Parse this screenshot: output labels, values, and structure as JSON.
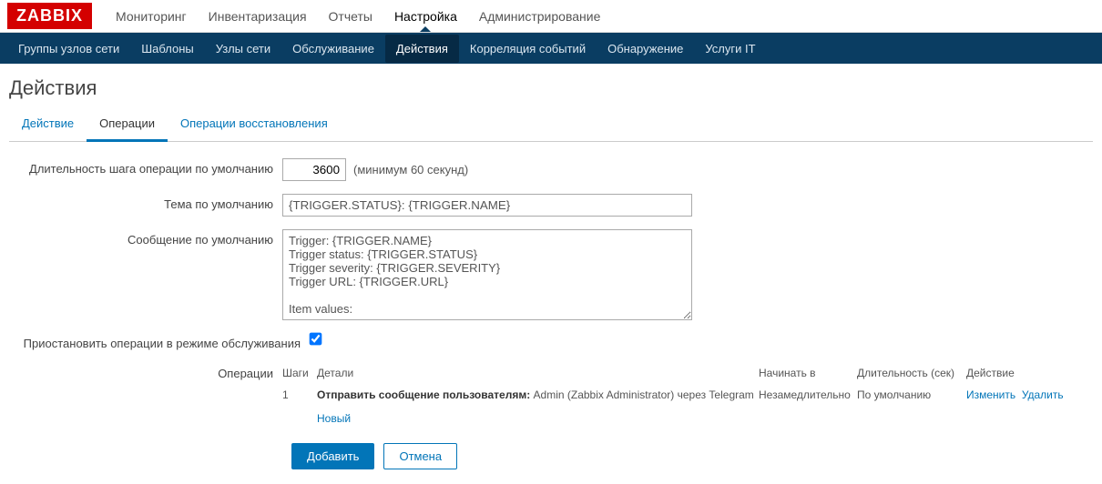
{
  "logo": "ZABBIX",
  "topnav": {
    "items": [
      {
        "label": "Мониторинг"
      },
      {
        "label": "Инвентаризация"
      },
      {
        "label": "Отчеты"
      },
      {
        "label": "Настройка",
        "active": true
      },
      {
        "label": "Администрирование"
      }
    ]
  },
  "subnav": {
    "items": [
      {
        "label": "Группы узлов сети"
      },
      {
        "label": "Шаблоны"
      },
      {
        "label": "Узлы сети"
      },
      {
        "label": "Обслуживание"
      },
      {
        "label": "Действия",
        "active": true
      },
      {
        "label": "Корреляция событий"
      },
      {
        "label": "Обнаружение"
      },
      {
        "label": "Услуги IT"
      }
    ]
  },
  "page": {
    "title": "Действия"
  },
  "tabs": {
    "items": [
      {
        "label": "Действие"
      },
      {
        "label": "Операции",
        "active": true
      },
      {
        "label": "Операции восстановления"
      }
    ]
  },
  "form": {
    "step_duration": {
      "label": "Длительность шага операции по умолчанию",
      "value": "3600",
      "hint": "(минимум 60 секунд)"
    },
    "default_subject": {
      "label": "Тема по умолчанию",
      "value": "{TRIGGER.STATUS}: {TRIGGER.NAME}"
    },
    "default_message": {
      "label": "Сообщение по умолчанию",
      "value": "Trigger: {TRIGGER.NAME}\nTrigger status: {TRIGGER.STATUS}\nTrigger severity: {TRIGGER.SEVERITY}\nTrigger URL: {TRIGGER.URL}\n\nItem values:\n"
    },
    "pause_maintenance": {
      "label": "Приостановить операции в режиме обслуживания",
      "checked": true
    },
    "operations": {
      "label": "Операции",
      "headers": {
        "steps": "Шаги",
        "details": "Детали",
        "start": "Начинать в",
        "duration": "Длительность (сек)",
        "action": "Действие"
      },
      "rows": [
        {
          "step": "1",
          "details_strong": "Отправить сообщение пользователям:",
          "details_rest": " Admin (Zabbix Administrator) через Telegram",
          "start": "Незамедлительно",
          "duration": "По умолчанию",
          "edit": "Изменить",
          "remove": "Удалить"
        }
      ],
      "new_link": "Новый"
    }
  },
  "buttons": {
    "add": "Добавить",
    "cancel": "Отмена"
  }
}
